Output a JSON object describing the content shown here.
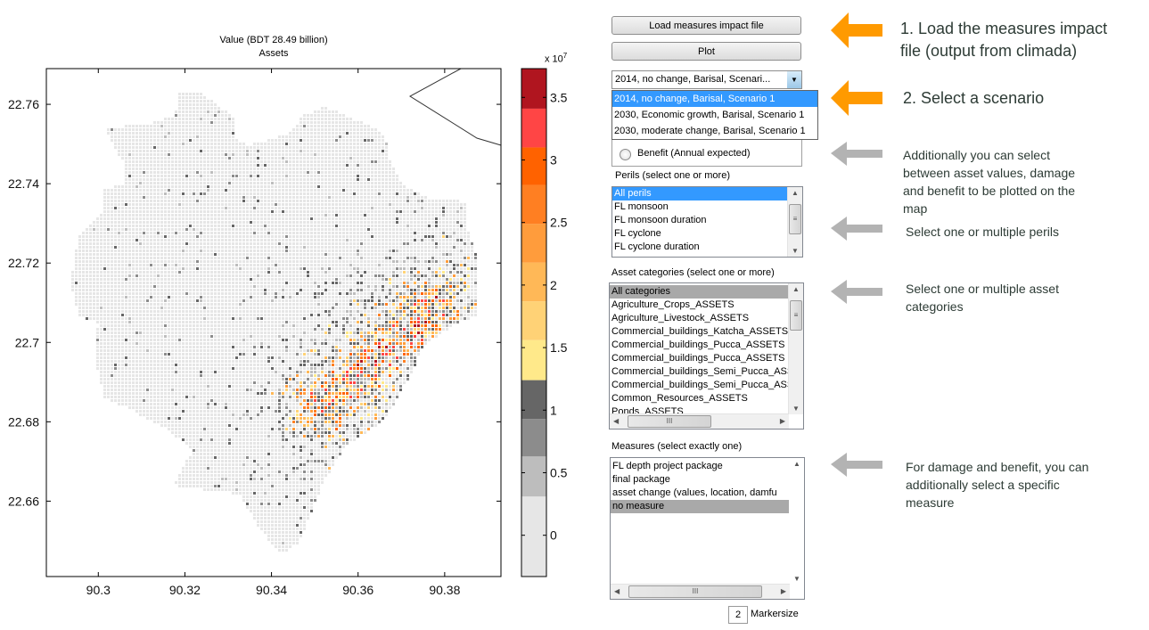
{
  "plot": {
    "title_line1": "Value (BDT 28.49 billion)",
    "title_line2": "Assets",
    "colorbar_exponent": "x 10",
    "colorbar_exponent_power": "7"
  },
  "chart_data": {
    "type": "heatmap",
    "title": "Value (BDT 28.49 billion)\nAssets",
    "xlim": [
      90.288,
      90.393
    ],
    "ylim": [
      22.641,
      22.769
    ],
    "x_ticks": [
      "90.3",
      "90.32",
      "90.34",
      "90.36",
      "90.38"
    ],
    "y_ticks": [
      "22.76",
      "22.74",
      "22.72",
      "22.7",
      "22.68",
      "22.66"
    ],
    "colorbar": {
      "range": [
        -0.33,
        3.73
      ],
      "scale_factor": "1e7",
      "ticks": [
        "0",
        "0.5",
        "1",
        "1.5",
        "2",
        "2.5",
        "3",
        "3.5"
      ],
      "band_edges": [
        -0.33,
        0.31,
        0.63,
        0.93,
        1.24,
        1.56,
        1.87,
        2.18,
        2.49,
        2.8,
        3.1,
        3.41,
        3.73
      ],
      "band_colors": [
        "#e6e6e6",
        "#bdbdbd",
        "#8c8c8c",
        "#666666",
        "#ffe98a",
        "#ffd276",
        "#ffb857",
        "#ff9c3c",
        "#ff7f22",
        "#ff6200",
        "#ff4545",
        "#b0151f"
      ]
    }
  },
  "controls": {
    "load_button": "Load measures impact file",
    "plot_button": "Plot",
    "scenario_selected": "2014, no change, Barisal, Scenari...",
    "scenario_options": [
      "2014, no change, Barisal, Scenario 1",
      "2030, Economic growth, Barisal, Scenario 1",
      "2030, moderate change, Barisal, Scenario 1"
    ],
    "radio_benefit": "Benefit (Annual expected)",
    "perils_label": "Perils (select one or more)",
    "perils": [
      "All perils",
      "FL monsoon",
      "FL monsoon duration",
      "FL cyclone",
      "FL cyclone duration"
    ],
    "assets_label": "Asset categories  (select one or more)",
    "assets": [
      "All categories",
      "Agriculture_Crops_ASSETS",
      "Agriculture_Livestock_ASSETS",
      "Commercial_buildings_Katcha_ASSETS",
      "Commercial_buildings_Pucca_ASSETS",
      "Commercial_buildings_Pucca_ASSETS",
      "Commercial_buildings_Semi_Pucca_ASSETS",
      "Commercial_buildings_Semi_Pucca_ASSETS",
      "Common_Resources_ASSETS",
      "Ponds_ASSETS"
    ],
    "measures_label": "Measures (select exactly one)",
    "measures": [
      "FL depth project package",
      "final package",
      "asset change (values, location, damfu",
      "no measure"
    ],
    "markersize_value": "2",
    "markersize_label": "Markersize"
  },
  "annotations": {
    "step1_line1": "1. Load the measures impact",
    "step1_line2": "file (output from climada)",
    "step2": "2. Select a scenario",
    "note_values": [
      "Additionally you can select",
      "between asset values, damage",
      "and benefit to be plotted on the",
      "map"
    ],
    "note_perils": "Select one or multiple perils",
    "note_assets": [
      "Select one or multiple asset",
      "categories"
    ],
    "note_measures": [
      "For damage and benefit, you can",
      "additionally select a specific",
      "measure"
    ],
    "accent_color": "#ff9900",
    "secondary_color": "#b3b3b3"
  }
}
